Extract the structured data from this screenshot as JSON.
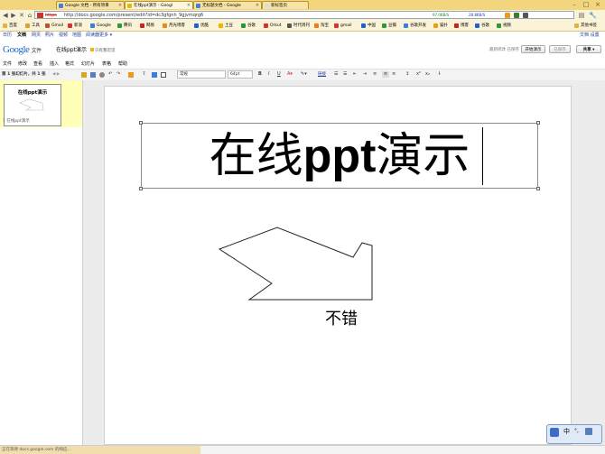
{
  "browser": {
    "tabs": [
      {
        "label": "Google 文档 - 所有项目"
      },
      {
        "label": "在线ppt演示 - Googl"
      },
      {
        "label": "无标题文档 - Google"
      },
      {
        "label": "新标签页"
      }
    ],
    "url": "http://docs.google.com/present/edit?id=dc3gfgnh_9gjvmqrg6",
    "speed_down": "97.0KB/S",
    "speed_up": "28.8KB/S",
    "bookmarks": [
      "百度",
      "工具",
      "Gmail",
      "新浪",
      "Google",
      "腾讯",
      "网易",
      "月光博客",
      "优酷",
      "土豆",
      "谷歌",
      "Orkut",
      "时代周刊",
      "淘宝",
      "gmail",
      "中国",
      "豆瓣",
      "谷歌开发",
      "猫扑",
      "博客",
      "谷歌",
      "视频",
      "其他书签"
    ]
  },
  "docs_nav": {
    "left": [
      "日历",
      "文档",
      "网页",
      "照片",
      "视频",
      "地图",
      "阅读器",
      "更多 ▾"
    ],
    "right": "文档 设置"
  },
  "header": {
    "logo_part1": "Google",
    "logo_part2": "文件",
    "doc_title": "在线ppt演示",
    "privacy": "只有我可见",
    "saved_status": "最新修改 已保存",
    "btn_present": "开始演示",
    "btn_saved": "已保存",
    "btn_share": "共享 ▾"
  },
  "menu": [
    "文件",
    "修改",
    "查看",
    "插入",
    "格式",
    "幻灯片",
    "表格",
    "帮助"
  ],
  "toolbar": {
    "slide_counter": "第 1 张幻灯片，共 1 张",
    "font": "常规",
    "size": "64pt",
    "bold": "B",
    "italic": "I",
    "underline": "U",
    "link": "链接"
  },
  "slides_panel": {
    "thumb_title": "在线ppt演示",
    "slide_label": "1  在线ppt演示"
  },
  "slide": {
    "title_cn1": "在线",
    "title_en": "ppt",
    "title_cn2": "演示",
    "caption": "不错"
  },
  "status": {
    "text": "正在等待 docs.google.com 的响应..."
  },
  "colors": {
    "tab_strip": "#f2d57c",
    "logo_blue": "#1a62d6",
    "logo_red": "#d8322c",
    "logo_yellow": "#e9b600",
    "logo_green": "#1e9a40",
    "slide_highlight": "#ffffb8"
  }
}
